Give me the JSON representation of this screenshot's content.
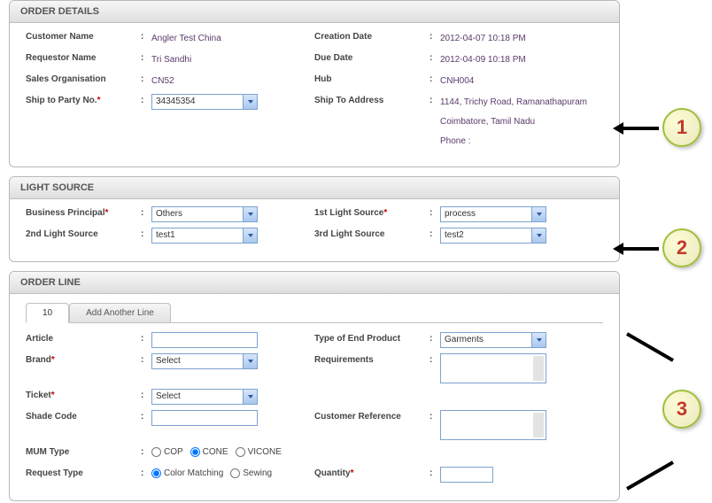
{
  "panels": {
    "orderDetails": {
      "title": "ORDER DETAILS",
      "customerName": {
        "label": "Customer Name",
        "value": "Angler Test China"
      },
      "requestorName": {
        "label": "Requestor Name",
        "value": "Tri Sandhi"
      },
      "salesOrg": {
        "label": "Sales Organisation",
        "value": "CN52"
      },
      "shipToParty": {
        "label": "Ship to Party No.",
        "value": "34345354",
        "required": true
      },
      "creationDate": {
        "label": "Creation Date",
        "value": "2012-04-07 10:18 PM"
      },
      "dueDate": {
        "label": "Due Date",
        "value": "2012-04-09 10:18 PM"
      },
      "hub": {
        "label": "Hub",
        "value": "CNH004"
      },
      "shipToAddress": {
        "label": "Ship To Address",
        "line1": "1144, Trichy Road, Ramanathapuram",
        "line2": "Coimbatore, Tamil Nadu",
        "line3": "Phone :"
      }
    },
    "lightSource": {
      "title": "LIGHT SOURCE",
      "businessPrincipal": {
        "label": "Business Principal",
        "value": "Others",
        "required": true
      },
      "secondLight": {
        "label": "2nd Light Source",
        "value": "test1"
      },
      "firstLight": {
        "label": "1st Light Source",
        "value": "process",
        "required": true
      },
      "thirdLight": {
        "label": "3rd Light Source",
        "value": "test2"
      }
    },
    "orderLine": {
      "title": "ORDER LINE",
      "tabs": {
        "tab1": "10",
        "tab2": "Add Another Line"
      },
      "article": {
        "label": "Article",
        "value": ""
      },
      "brand": {
        "label": "Brand",
        "value": "Select",
        "required": true
      },
      "ticket": {
        "label": "Ticket",
        "value": "Select",
        "required": true
      },
      "shadeCode": {
        "label": "Shade Code",
        "value": ""
      },
      "mumType": {
        "label": "MUM Type",
        "opt1": "COP",
        "opt2": "CONE",
        "opt3": "VICONE",
        "selected": "CONE"
      },
      "requestType": {
        "label": "Request Type",
        "opt1": "Color Matching",
        "opt2": "Sewing",
        "selected": "Color Matching"
      },
      "typeEndProduct": {
        "label": "Type of End Product",
        "value": "Garments"
      },
      "requirements": {
        "label": "Requirements",
        "value": ""
      },
      "customerRef": {
        "label": "Customer Reference",
        "value": ""
      },
      "quantity": {
        "label": "Quantity",
        "value": "",
        "required": true
      }
    }
  },
  "callouts": {
    "c1": "1",
    "c2": "2",
    "c3": "3"
  }
}
